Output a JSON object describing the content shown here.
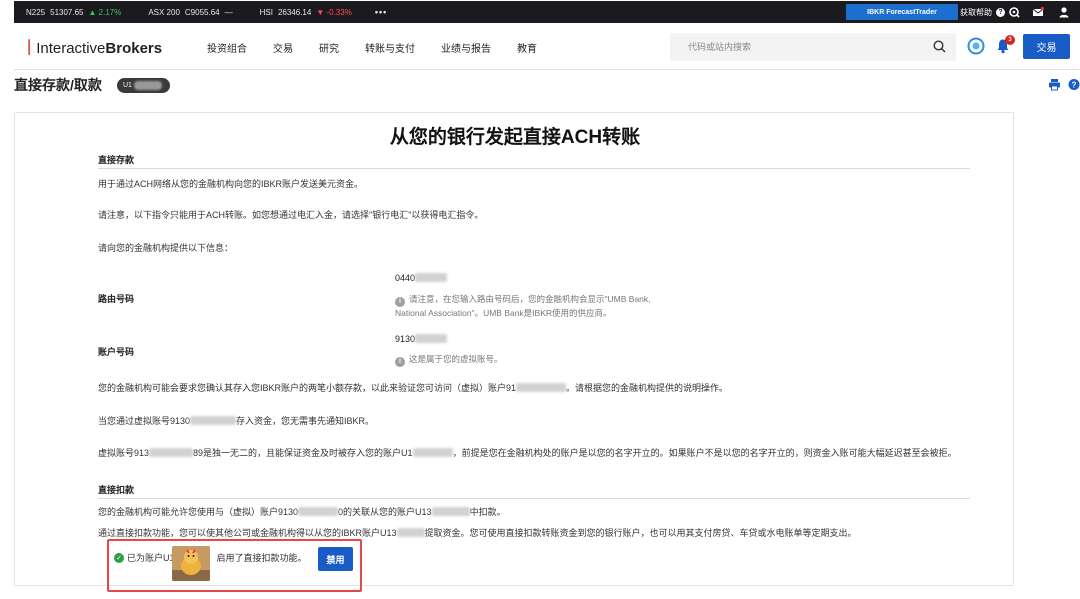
{
  "ticker": {
    "quotes": [
      {
        "name": "N225",
        "value": "51307.65",
        "change": "▲ 2.17%",
        "dir": "up"
      },
      {
        "name": "ASX 200",
        "value": "C9055.64",
        "change": "—",
        "dir": "flat"
      },
      {
        "name": "HSI",
        "value": "26346.14",
        "change": "▼ -0.33%",
        "dir": "down"
      }
    ],
    "more": "•••",
    "forecast_trader": "IBKR ForecastTrader",
    "help_label": "获取帮助",
    "icons": [
      "question-icon",
      "chat-icon",
      "mail-icon",
      "user-icon"
    ]
  },
  "nav": {
    "logo_brand": "Interactive",
    "logo_brand_bold": "Brokers",
    "menu": [
      "投资组合",
      "交易",
      "研究",
      "转账与支付",
      "业绩与报告",
      "教育"
    ],
    "search_placeholder": "代码或站内搜索",
    "notification_count": "3",
    "trade_label": "交易"
  },
  "page": {
    "title": "直接存款/取款",
    "account_prefix": "U1"
  },
  "card": {
    "title": "从您的银行发起直接ACH转账",
    "deposit_heading": "直接存款",
    "deposit_p1": "用于通过ACH网络从您的金融机构向您的IBKR账户发送美元资金。",
    "deposit_p2": "请注意，以下指令只能用于ACH转账。如您想通过电汇入金，请选择\"银行电汇\"以获得电汇指令。",
    "deposit_p3": "请向您的金融机构提供以下信息：",
    "routing_label": "路由号码",
    "routing_value": "0440",
    "routing_note": "请注意，在您输入路由号码后，您的金融机构会显示\"UMB Bank, National Association\"。UMB Bank是IBKR使用的供应商。",
    "account_label": "账户号码",
    "account_value": "9130",
    "account_note": "这是属于您的虚拟账号。",
    "verify_pre": "您的金融机构可能会要求您确认其存入您IBKR账户的两笔小额存款，以此来验证您可访问（虚拟）账户91",
    "verify_post": "。请根据您的金融机构提供的说明操作。",
    "notify_pre": "当您通过虚拟账号9130",
    "notify_post": "存入资金，您无需事先通知IBKR。",
    "unique_a": "虚拟账号913",
    "unique_b": "89是独一无二的，且能保证资金及时被存入您的账户U1",
    "unique_c": "，前提是您在金融机构处的账户是以您的名字开立的。如果账户不是以您的名字开立的，则资金入账可能大幅延迟甚至会被拒。",
    "debit_heading": "直接扣款",
    "debit_p1_a": "您的金融机构可能允许您使用与（虚拟）账户9130",
    "debit_p1_b": "0的关联从您的账户U13",
    "debit_p1_c": "中扣款。",
    "debit_p2_a": "通过直接扣款功能，您可以使其他公司或金融机构得以从您的IBKR账户U13",
    "debit_p2_b": "提取资金。您可使用直接扣款转账资金到您的银行账户，也可以用其支付房贷、车贷或水电账单等定期支出。",
    "status_pre": "已为账户U1",
    "status_post": "启用了直接扣款功能。",
    "disable_label": "禁用"
  }
}
